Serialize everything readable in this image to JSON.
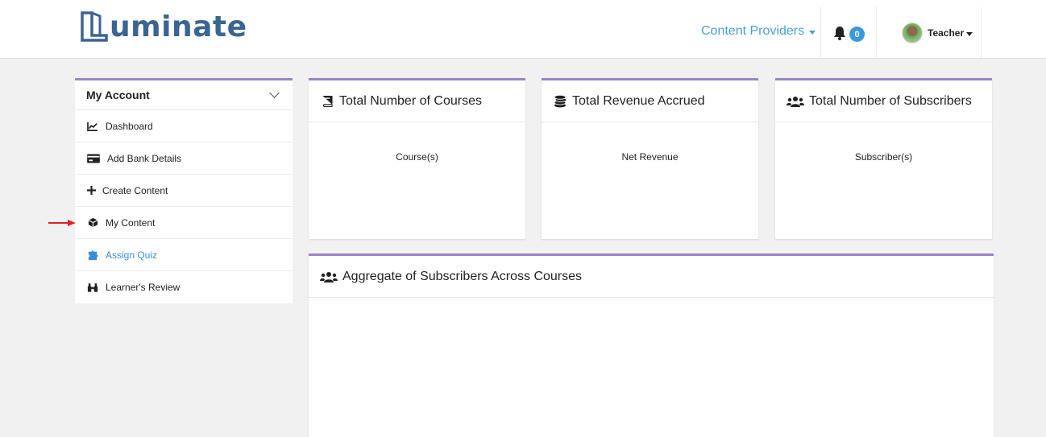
{
  "header": {
    "logo_text": "uminate",
    "nav_providers": "Content Providers",
    "notification_count": "0",
    "user_name": "Teacher"
  },
  "sidebar": {
    "title": "My Account",
    "items": [
      {
        "label": "Dashboard",
        "icon": "chart-line-icon"
      },
      {
        "label": "Add Bank Details",
        "icon": "bank-card-icon"
      },
      {
        "label": "Create Content",
        "icon": "plus-icon"
      },
      {
        "label": "My Content",
        "icon": "box-icon"
      },
      {
        "label": "Assign Quiz",
        "icon": "puzzle-icon"
      },
      {
        "label": "Learner's Review",
        "icon": "binoculars-icon"
      }
    ]
  },
  "cards": {
    "courses": {
      "title": "Total Number of Courses",
      "body": "Course(s)"
    },
    "revenue": {
      "title": "Total Revenue Accrued",
      "body": "Net Revenue"
    },
    "subscribers": {
      "title": "Total Number of Subscribers",
      "body": "Subscriber(s)"
    },
    "aggregate": {
      "title": "Aggregate of Subscribers Across Courses"
    }
  },
  "colors": {
    "accent": "#9b86c4",
    "link": "#4a9fd8",
    "badge": "#3a9ad9",
    "logo": "#3a6590",
    "arrow": "#e0201e"
  }
}
